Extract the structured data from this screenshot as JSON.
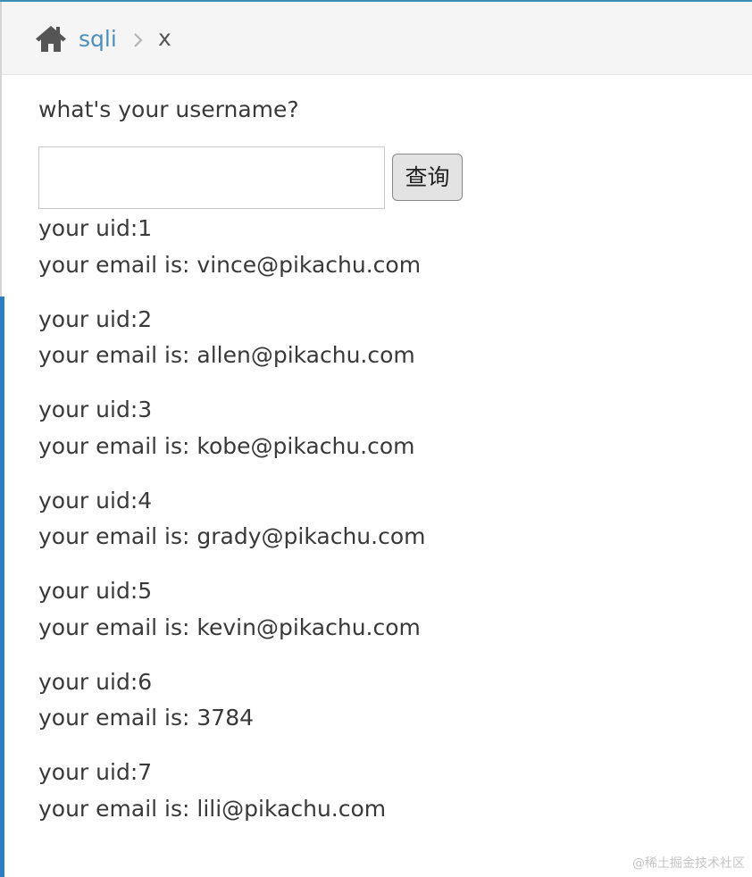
{
  "breadcrumbs": {
    "home_icon": "home-icon",
    "link_label": "sqli",
    "separator_icon": "chevron-right-icon",
    "active_label": "x"
  },
  "form": {
    "question": "what's your username?",
    "input_value": "",
    "button_label": "查询"
  },
  "results": [
    {
      "uid_line": "your uid:1",
      "email_line": "your email is: vince@pikachu.com"
    },
    {
      "uid_line": "your uid:2",
      "email_line": "your email is: allen@pikachu.com"
    },
    {
      "uid_line": "your uid:3",
      "email_line": "your email is: kobe@pikachu.com"
    },
    {
      "uid_line": "your uid:4",
      "email_line": "your email is: grady@pikachu.com"
    },
    {
      "uid_line": "your uid:5",
      "email_line": "your email is: kevin@pikachu.com"
    },
    {
      "uid_line": "your uid:6",
      "email_line": "your email is: 3784"
    },
    {
      "uid_line": "your uid:7",
      "email_line": "your email is: lili@pikachu.com"
    }
  ],
  "watermark": "@稀土掘金技术社区",
  "colors": {
    "link": "#4c8fbd",
    "accent_rail": "#2b7dc4",
    "text": "#393939"
  }
}
